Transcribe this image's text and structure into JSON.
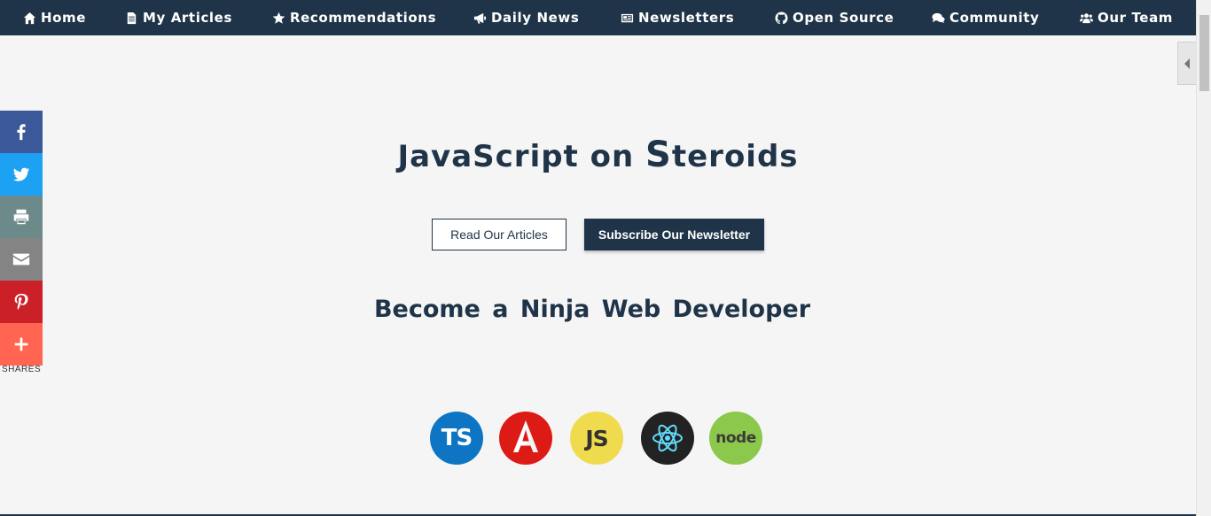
{
  "nav": {
    "items": [
      {
        "label": "Home",
        "icon": "home-icon"
      },
      {
        "label": "My Articles",
        "icon": "file-icon"
      },
      {
        "label": "Recommendations",
        "icon": "star-icon"
      },
      {
        "label": "Daily News",
        "icon": "bullhorn-icon"
      },
      {
        "label": "Newsletters",
        "icon": "newspaper-icon"
      },
      {
        "label": "Open Source",
        "icon": "github-icon"
      },
      {
        "label": "Community",
        "icon": "comments-icon"
      },
      {
        "label": "Our Team",
        "icon": "users-icon"
      }
    ]
  },
  "share": {
    "buttons": [
      {
        "name": "facebook",
        "color": "#3b5998",
        "icon": "facebook-icon"
      },
      {
        "name": "twitter",
        "color": "#1da1f2",
        "icon": "twitter-icon"
      },
      {
        "name": "print",
        "color": "#6d8a8a",
        "icon": "print-icon"
      },
      {
        "name": "email",
        "color": "#848484",
        "icon": "email-icon"
      },
      {
        "name": "pinterest",
        "color": "#cb2027",
        "icon": "pinterest-icon"
      },
      {
        "name": "more",
        "color": "#ff6550",
        "icon": "plus-icon"
      }
    ],
    "label": "SHARES"
  },
  "hero": {
    "title_prefix": "JavaScript on ",
    "title_s": "S",
    "title_suffix": "teroids",
    "primary_button": "Subscribe Our Newsletter",
    "secondary_button": "Read Our Articles",
    "subtitle": "Become a Ninja Web Developer"
  },
  "technologies": [
    {
      "name": "TypeScript",
      "text": "TS",
      "color": "#0d75c3"
    },
    {
      "name": "Angular",
      "text": "A",
      "color": "#dd1b16"
    },
    {
      "name": "JavaScript",
      "text": "JS",
      "color": "#f0db4f"
    },
    {
      "name": "React",
      "text": "",
      "color": "#222222"
    },
    {
      "name": "Node.js",
      "text": "node",
      "color": "#8cc84b"
    }
  ],
  "colors": {
    "brand": "#1f3448",
    "background": "#f5f5f5"
  }
}
